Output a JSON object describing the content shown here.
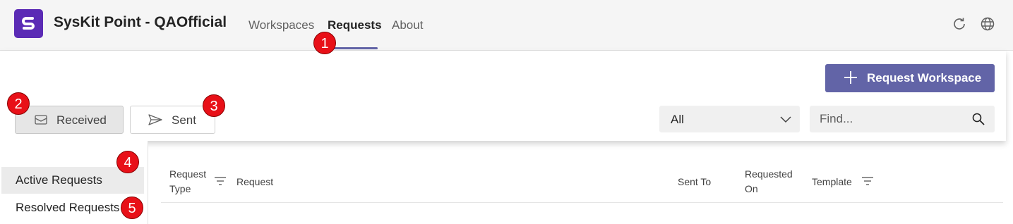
{
  "header": {
    "app_title": "SysKit Point - QAOfficial",
    "tabs": [
      {
        "label": "Workspaces",
        "active": false
      },
      {
        "label": "Requests",
        "active": true
      },
      {
        "label": "About",
        "active": false
      }
    ],
    "icons": [
      "refresh-icon",
      "globe-icon"
    ]
  },
  "toolbar": {
    "primary_button": "Request Workspace",
    "toggle": [
      {
        "label": "Received",
        "icon": "mail-icon",
        "selected": true
      },
      {
        "label": "Sent",
        "icon": "send-icon",
        "selected": false
      }
    ],
    "filter_dropdown": {
      "value": "All"
    },
    "search": {
      "placeholder": "Find..."
    }
  },
  "leftnav": {
    "items": [
      {
        "label": "Active Requests",
        "active": true
      },
      {
        "label": "Resolved Requests",
        "active": false
      }
    ]
  },
  "table": {
    "columns": [
      {
        "line1": "Request",
        "line2": "Type",
        "filter": true
      },
      {
        "line1": "Request",
        "line2": "",
        "filter": false
      },
      {
        "line1": "Sent To",
        "line2": "",
        "filter": false
      },
      {
        "line1": "Requested",
        "line2": "On",
        "filter": false
      },
      {
        "line1": "Template",
        "line2": "",
        "filter": true
      }
    ]
  },
  "callouts": [
    "1",
    "2",
    "3",
    "4",
    "5"
  ],
  "colors": {
    "accent": "#6264a7",
    "logo": "#5b2bb5",
    "callout": "#e81018"
  }
}
